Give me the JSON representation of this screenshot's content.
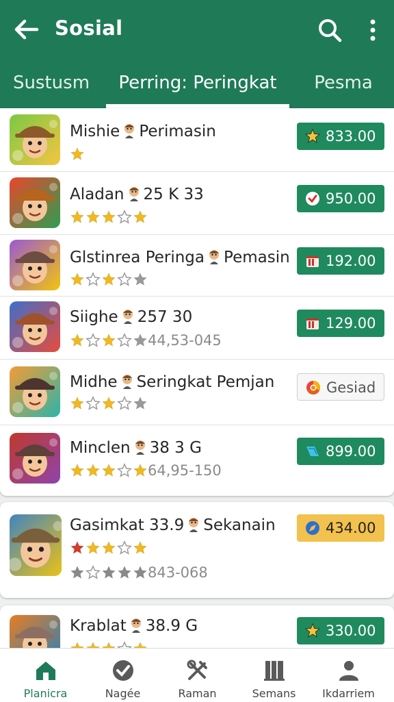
{
  "header": {
    "title": "Sosial"
  },
  "tabs": [
    {
      "label": "Sustusm"
    },
    {
      "label": "Perring: Peringkat"
    },
    {
      "label": "Pesma"
    }
  ],
  "apps": [
    {
      "name": "Mishie",
      "name_suffix": "Perimasin",
      "rating": 1,
      "rating_text": "",
      "price": "833.00",
      "price_icon": "star-icon",
      "price_style": "green"
    },
    {
      "name": "Aladan",
      "name_suffix": "25 K 33",
      "rating": 4,
      "rating_text": "",
      "price": "950.00",
      "price_icon": "shield-check-icon",
      "price_style": "green"
    },
    {
      "name": "Glstinrea Peringa",
      "name_suffix": "Pemasin",
      "rating": 1,
      "rating_text": "",
      "price": "192.00",
      "price_icon": "gift-icon",
      "price_style": "green"
    },
    {
      "name": "Siighe",
      "name_suffix": "257 30",
      "rating": 1,
      "rating_text": "44,53-045",
      "price": "129.00",
      "price_icon": "gift-icon",
      "price_style": "green"
    },
    {
      "name": "Midhe",
      "name_suffix": "Seringkat Pemjan",
      "rating": 1,
      "rating_text": "",
      "price": "Gesiad",
      "price_icon": "chrome-icon",
      "price_style": "outline"
    },
    {
      "name": "Minclen",
      "name_suffix": "38 3 G",
      "rating": 2,
      "rating_text": "64,95-150",
      "price": "899.00",
      "price_icon": "tag-icon",
      "price_style": "green"
    },
    {
      "name": "Gasimkat 33.9",
      "name_suffix": "Sekanain",
      "rating": 3,
      "rating_text": "843-068",
      "price": "434.00",
      "price_icon": "compass-icon",
      "price_style": "gold"
    },
    {
      "name": "Krablat",
      "name_suffix": "38.9 G",
      "rating": 2,
      "rating_text": "",
      "price": "330.00",
      "price_icon": "star-icon",
      "price_style": "green"
    }
  ],
  "bottom_nav": [
    {
      "label": "Planicra",
      "icon": "home-icon",
      "active": true
    },
    {
      "label": "Nagée",
      "icon": "check-circle-icon",
      "active": false
    },
    {
      "label": "Raman",
      "icon": "tools-icon",
      "active": false
    },
    {
      "label": "Semans",
      "icon": "library-icon",
      "active": false
    },
    {
      "label": "Ikdarriem",
      "icon": "person-icon",
      "active": false
    }
  ],
  "colors": {
    "primary": "#1f7a58",
    "button": "#1f8a5e",
    "star": "#f2b91c",
    "gold_button": "#f2c14e"
  }
}
